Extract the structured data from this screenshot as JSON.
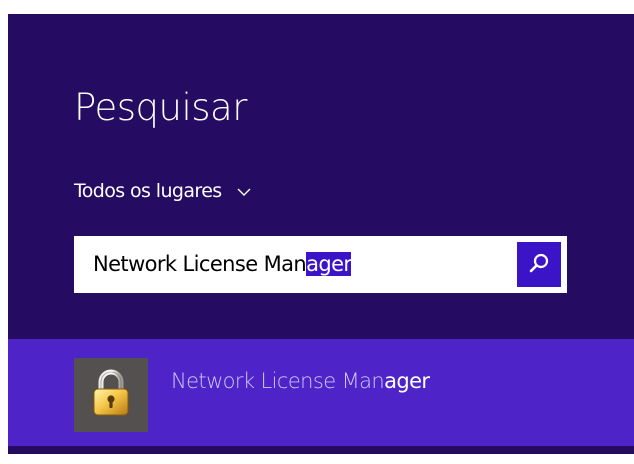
{
  "charm": {
    "title": "Pesquisar",
    "scope": {
      "label": "Todos os lugares",
      "icon": "chevron-down-icon"
    },
    "search": {
      "value_typed": "Network License Man",
      "value_selected": "ager",
      "button_icon": "magnifier-icon",
      "accent_color": "#3c14c8"
    },
    "results": [
      {
        "label_prefix": "Network License Man",
        "label_match": "ager",
        "icon": "padlock-icon"
      }
    ],
    "colors": {
      "background": "#250b61",
      "result_highlight": "#4e24c8",
      "accent": "#3c14c8"
    }
  }
}
